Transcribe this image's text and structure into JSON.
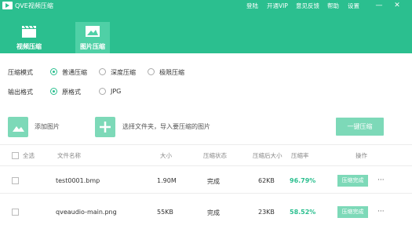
{
  "app": {
    "title": "QVE视频压缩"
  },
  "titlebar": {
    "menu": [
      "登陆",
      "开通VIP",
      "意见反馈",
      "帮助",
      "设置"
    ],
    "minimize": "—",
    "close": "✕"
  },
  "tabs": [
    {
      "label": "视频压缩",
      "active": false
    },
    {
      "label": "图片压缩",
      "active": true
    }
  ],
  "options": {
    "mode": {
      "label": "压缩模式",
      "choices": [
        "普通压缩",
        "深度压缩",
        "极限压缩"
      ],
      "selected": "普通压缩"
    },
    "format": {
      "label": "输出格式",
      "choices": [
        "原格式",
        "JPG"
      ],
      "selected": "原格式"
    }
  },
  "actions": {
    "add_image": "添加图片",
    "select_folder": "选择文件夹，导入要压缩的图片",
    "compress_all": "一键压缩"
  },
  "table": {
    "headers": {
      "select_all": "全选",
      "filename": "文件名称",
      "size": "大小",
      "status": "压缩状态",
      "compressed_size": "压缩后大小",
      "rate": "压缩率",
      "actions": "操作"
    },
    "rows": [
      {
        "filename": "test0001.bmp",
        "size": "1.90M",
        "status": "完成",
        "compressed_size": "62KB",
        "rate": "96.79%",
        "button": "压缩完成",
        "more": "···"
      },
      {
        "filename": "qveaudio-main.png",
        "size": "55KB",
        "status": "完成",
        "compressed_size": "23KB",
        "rate": "58.52%",
        "button": "压缩完成",
        "more": "···"
      }
    ]
  },
  "colors": {
    "brand": "#2bbf8f",
    "tab_active": "#4fd0a6",
    "button": "#7dd9b8"
  }
}
